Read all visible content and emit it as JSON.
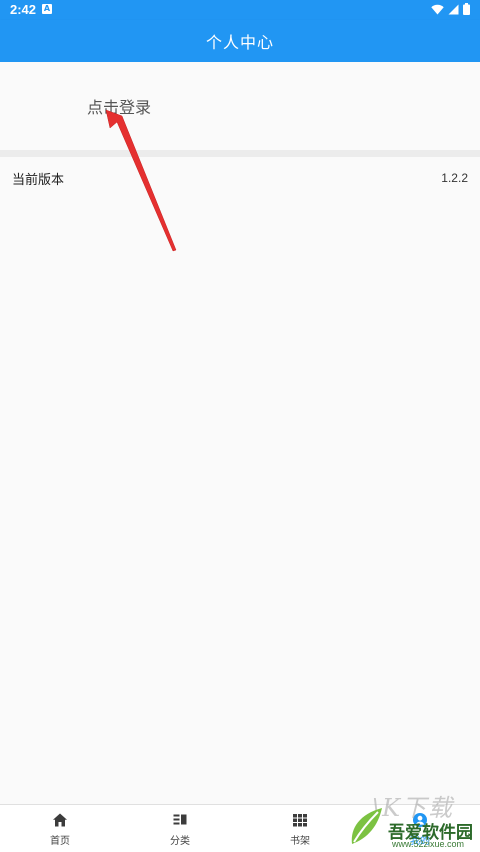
{
  "status_bar": {
    "time": "2:42",
    "notification_glyph": "A",
    "icons": [
      "wifi-icon",
      "signal-icon",
      "battery-icon"
    ]
  },
  "app_bar": {
    "title": "个人中心"
  },
  "login": {
    "label": "点击登录"
  },
  "settings": {
    "version_label": "当前版本",
    "version_value": "1.2.2"
  },
  "bottom_nav": {
    "items": [
      {
        "label": "首页",
        "icon": "home-icon"
      },
      {
        "label": "分类",
        "icon": "category-icon"
      },
      {
        "label": "书架",
        "icon": "grid-icon"
      },
      {
        "label": "我的",
        "icon": "profile-icon"
      }
    ]
  },
  "watermark": {
    "brand": "吾爱软件园",
    "url": "www.52zixue.com"
  },
  "colors": {
    "primary": "#2196f3",
    "arrow": "#e53030",
    "background": "#fafafa"
  }
}
